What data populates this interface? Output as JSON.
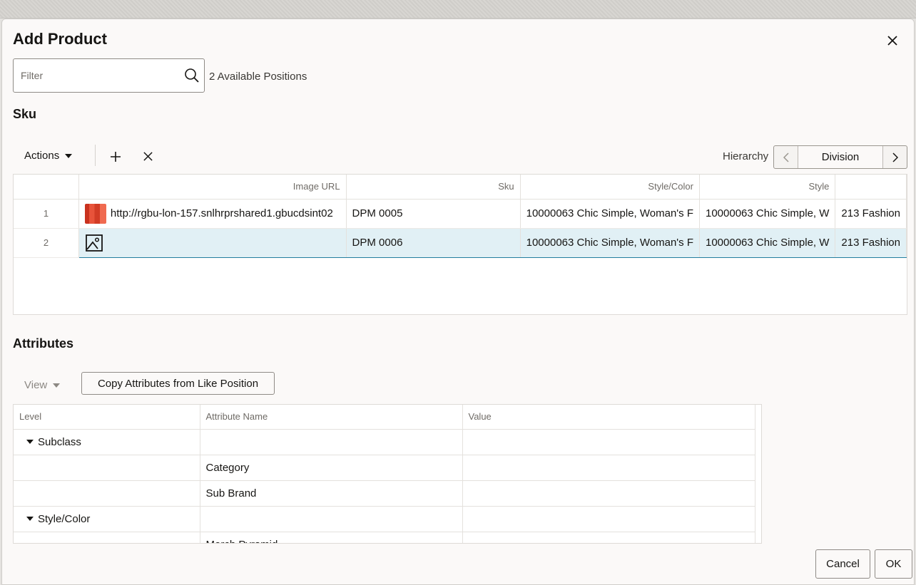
{
  "dialog": {
    "title": "Add Product",
    "close_icon": "close-icon"
  },
  "filter": {
    "placeholder": "Filter",
    "value": "",
    "available_positions": "2 Available Positions"
  },
  "sku_section": {
    "title": "Sku",
    "toolbar": {
      "actions_label": "Actions",
      "add_icon": "plus-icon",
      "remove_icon": "close-icon",
      "hierarchy_label": "Hierarchy",
      "hierarchy_value": "Division"
    },
    "columns": [
      "",
      "Image URL",
      "Sku",
      "Style/Color",
      "Style",
      ""
    ],
    "rows": [
      {
        "num": "1",
        "image_url": "http://rgbu-lon-157.snlhrprshared1.gbucdsint02",
        "sku": "DPM 0005",
        "style_color": "10000063 Chic Simple, Woman's F",
        "style": "10000063 Chic Simple, W",
        "extra": "213 Fashion"
      },
      {
        "num": "2",
        "image_url": "",
        "sku": "DPM 0006",
        "style_color": "10000063 Chic Simple, Woman's F",
        "style": "10000063 Chic Simple, W",
        "extra": "213 Fashion"
      }
    ]
  },
  "attributes_section": {
    "title": "Attributes",
    "view_label": "View",
    "copy_button": "Copy Attributes from Like Position",
    "columns": [
      "Level",
      "Attribute Name",
      "Value"
    ],
    "rows": [
      {
        "level": "Subclass",
        "name": "",
        "value": ""
      },
      {
        "level": "",
        "name": "Category",
        "value": ""
      },
      {
        "level": "",
        "name": "Sub Brand",
        "value": ""
      },
      {
        "level": "Style/Color",
        "name": "",
        "value": ""
      },
      {
        "level": "",
        "name": "Merch Pyramid",
        "value": ""
      }
    ]
  },
  "footer": {
    "cancel_label": "Cancel",
    "ok_label": "OK"
  },
  "colors": {
    "selected_row": "#e1f0f5",
    "selected_border": "#227e9e",
    "dialog_bg": "#fbf9f8"
  }
}
